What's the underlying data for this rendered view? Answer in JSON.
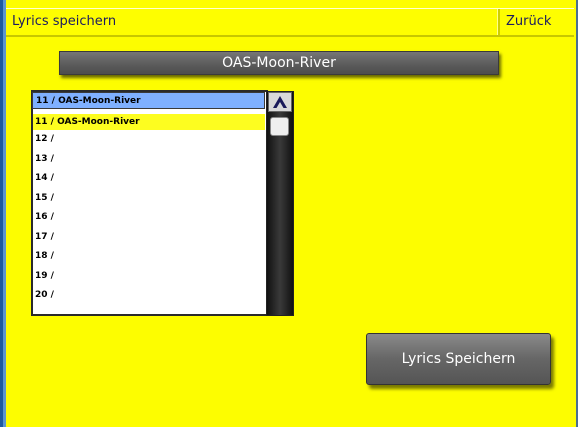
{
  "titlebar": {
    "title": "Lyrics speichern",
    "back_label": "Zurück"
  },
  "name_bar": {
    "text": "OAS-Moon-River"
  },
  "list": {
    "header": "11 / OAS-Moon-River",
    "items": [
      "11 / OAS-Moon-River",
      "12 /",
      "13 /",
      "14 /",
      "15 /",
      "16 /",
      "17 /",
      "18 /",
      "19 /",
      "20 /"
    ],
    "selected_index": 0
  },
  "scroll": {
    "up_icon": "chevron-up-icon"
  },
  "save_button": {
    "label": "Lyrics Speichern"
  },
  "colors": {
    "background": "#fdfd00",
    "header_highlight": "#7fb0ff",
    "selected_row": "#fdfd20",
    "button_gray": "#666666"
  }
}
